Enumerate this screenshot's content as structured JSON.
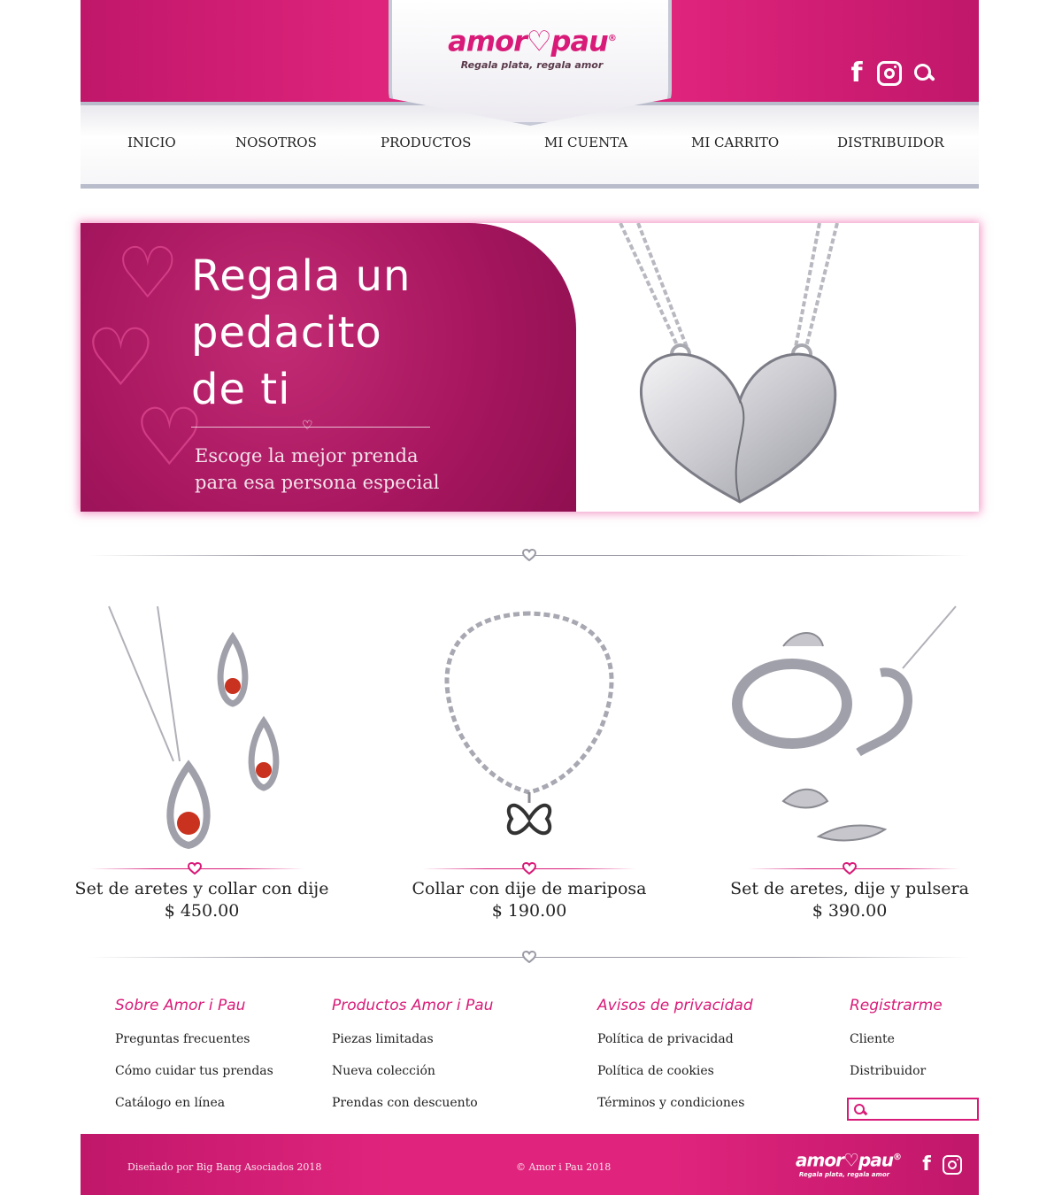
{
  "brand": {
    "logo_word_left": "amor",
    "logo_word_right": "pau",
    "logo_heart": "♡",
    "logo_reg": "®",
    "tagline": "Regala plata, regala amor",
    "pink": "#d81b78",
    "header_pink": "#e0247d"
  },
  "header_icons": [
    "facebook-icon",
    "instagram-icon",
    "search-icon"
  ],
  "nav": [
    {
      "label": "INICIO"
    },
    {
      "label": "NOSOTROS"
    },
    {
      "label": "PRODUCTOS"
    },
    {
      "label": "MI CUENTA"
    },
    {
      "label": "MI CARRITO"
    },
    {
      "label": "DISTRIBUIDOR"
    }
  ],
  "hero": {
    "title_line1": "Regala un",
    "title_line2": "pedacito",
    "title_line3": "de ti",
    "subtitle_line1": "Escoge la mejor prenda",
    "subtitle_line2": "para esa persona especial"
  },
  "products": [
    {
      "name": "Set de aretes y collar con dije",
      "price": "$ 450.00"
    },
    {
      "name": "Collar con dije de mariposa",
      "price": "$ 190.00"
    },
    {
      "name": "Set de aretes, dije y pulsera",
      "price": "$ 390.00"
    }
  ],
  "footer": {
    "columns": [
      {
        "title": "Sobre Amor i Pau",
        "links": [
          "Preguntas frecuentes",
          "Cómo cuidar tus prendas",
          "Catálogo en línea"
        ]
      },
      {
        "title": "Productos Amor i Pau",
        "links": [
          "Piezas limitadas",
          "Nueva colección",
          "Prendas con descuento"
        ]
      },
      {
        "title": "Avisos de privacidad",
        "links": [
          "Política de privacidad",
          "Política de cookies",
          "Términos y condiciones"
        ]
      },
      {
        "title": "Registrarme",
        "links": [
          "Cliente",
          "Distribuidor"
        ]
      }
    ],
    "search_value": ""
  },
  "bottom_bar": {
    "designed_by": "Diseñado por Big Bang Asociados 2018",
    "copyright": "© Amor i Pau 2018"
  }
}
